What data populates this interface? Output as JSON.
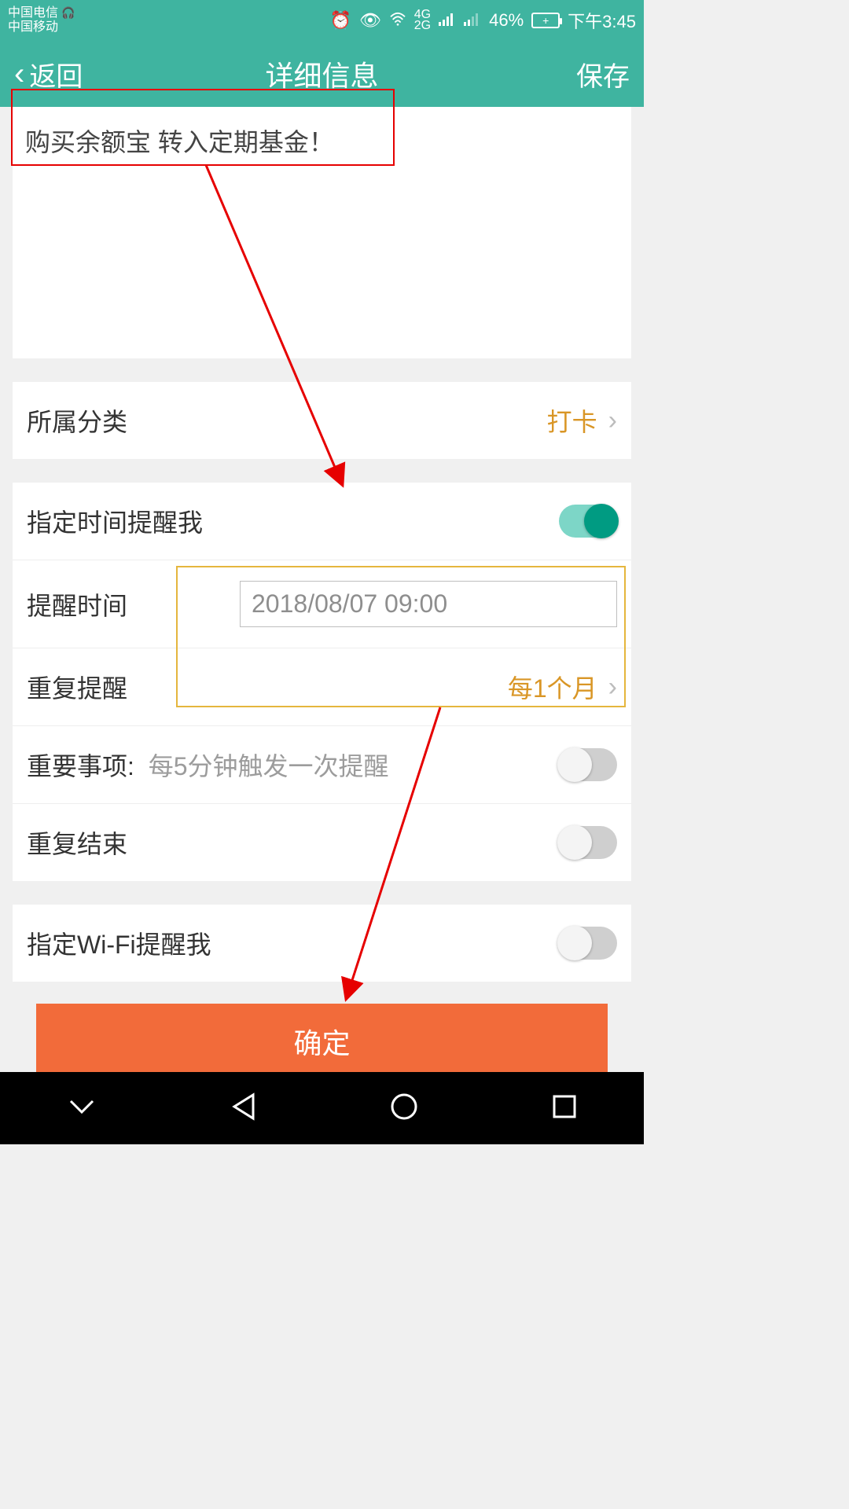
{
  "status_bar": {
    "carrier1": "中国电信",
    "carrier2": "中国移动",
    "battery_pct": "46%",
    "time": "下午3:45",
    "signal_labels": {
      "g4": "4G",
      "g2": "2G"
    }
  },
  "app_bar": {
    "back_label": "返回",
    "title": "详细信息",
    "save_label": "保存"
  },
  "note": {
    "text": "购买余额宝 转入定期基金！"
  },
  "category_row": {
    "label": "所属分类",
    "value": "打卡"
  },
  "reminder": {
    "toggle_label": "指定时间提醒我",
    "toggle_on": true,
    "time_label": "提醒时间",
    "time_value": "2018/08/07 09:00",
    "repeat_label": "重复提醒",
    "repeat_value": "每1个月",
    "important_label": "重要事项:",
    "important_desc": "每5分钟触发一次提醒",
    "important_on": false,
    "repeat_end_label": "重复结束",
    "repeat_end_on": false
  },
  "wifi_row": {
    "label": "指定Wi-Fi提醒我",
    "on": false
  },
  "confirm_button": "确定",
  "colors": {
    "primary": "#3fb4a0",
    "accent_orange": "#d99626",
    "button_bg": "#f26b3a",
    "annotation_red": "#e60000",
    "annotation_gold": "#e5b63d"
  }
}
